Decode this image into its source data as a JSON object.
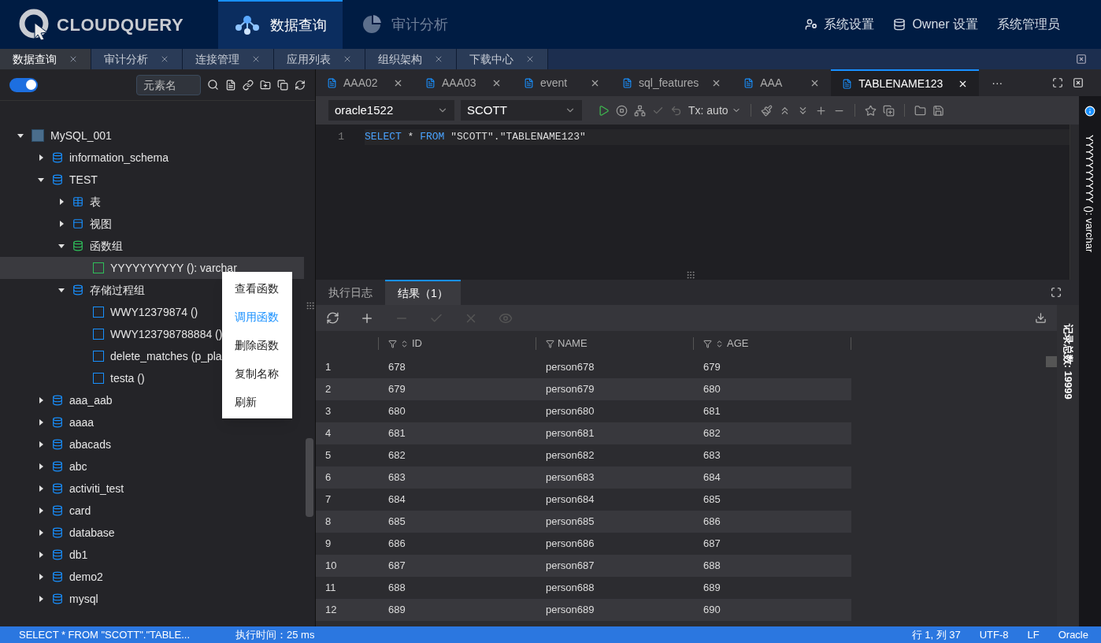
{
  "header": {
    "logo": "CLOUDQUERY",
    "nav": [
      {
        "label": "数据查询",
        "selected": true
      },
      {
        "label": "审计分析",
        "selected": false
      }
    ],
    "links": [
      {
        "label": "系统设置"
      },
      {
        "label": "Owner 设置"
      }
    ],
    "user": "系统管理员"
  },
  "page_tabs": [
    {
      "label": "数据查询",
      "selected": true
    },
    {
      "label": "审计分析",
      "selected": false
    },
    {
      "label": "连接管理",
      "selected": false
    },
    {
      "label": "应用列表",
      "selected": false
    },
    {
      "label": "组织架构",
      "selected": false
    },
    {
      "label": "下载中心",
      "selected": false
    }
  ],
  "sidebar": {
    "theme_toggle": {
      "on": true
    },
    "search": {
      "placeholder": "元素名"
    },
    "tree": [
      {
        "label": "MySQL_001",
        "kind": "connection",
        "expanded": true,
        "selected": false,
        "children": [
          {
            "label": "information_schema",
            "kind": "database",
            "expanded": false,
            "selected": false
          },
          {
            "label": "TEST",
            "kind": "database",
            "expanded": true,
            "selected": false,
            "children": [
              {
                "label": "表",
                "kind": "table_group",
                "expanded": false,
                "selected": false
              },
              {
                "label": "视图",
                "kind": "view_group",
                "expanded": false,
                "selected": false
              },
              {
                "label": "函数组",
                "kind": "function_group",
                "expanded": true,
                "selected": false,
                "children": [
                  {
                    "label": "YYYYYYYYYY (): varchar",
                    "kind": "function",
                    "selected": true
                  }
                ]
              },
              {
                "label": "存储过程组",
                "kind": "procedure_group",
                "expanded": true,
                "selected": false,
                "children": [
                  {
                    "label": "WWY12379874 ()",
                    "kind": "procedure",
                    "selected": false
                  },
                  {
                    "label": "WWY123798788884 ()",
                    "kind": "procedure",
                    "selected": false
                  },
                  {
                    "label": "delete_matches (p_pla",
                    "kind": "procedure",
                    "selected": false
                  },
                  {
                    "label": "testa ()",
                    "kind": "procedure",
                    "selected": false
                  }
                ]
              }
            ]
          },
          {
            "label": "aaa_aab",
            "kind": "database",
            "expanded": false,
            "selected": false
          },
          {
            "label": "aaaa",
            "kind": "database",
            "expanded": false,
            "selected": false
          },
          {
            "label": "abacads",
            "kind": "database",
            "expanded": false,
            "selected": false
          },
          {
            "label": "abc",
            "kind": "database",
            "expanded": false,
            "selected": false
          },
          {
            "label": "activiti_test",
            "kind": "database",
            "expanded": false,
            "selected": false
          },
          {
            "label": "card",
            "kind": "database",
            "expanded": false,
            "selected": false
          },
          {
            "label": "database",
            "kind": "database",
            "expanded": false,
            "selected": false
          },
          {
            "label": "db1",
            "kind": "database",
            "expanded": false,
            "selected": false
          },
          {
            "label": "demo2",
            "kind": "database",
            "expanded": false,
            "selected": false
          },
          {
            "label": "mysql",
            "kind": "database",
            "expanded": false,
            "selected": false
          }
        ]
      }
    ]
  },
  "context_menu": [
    {
      "label": "查看函数",
      "selected": false
    },
    {
      "label": "调用函数",
      "selected": true
    },
    {
      "label": "删除函数",
      "selected": false
    },
    {
      "label": "复制名称",
      "selected": false
    },
    {
      "label": "刷新",
      "selected": false
    }
  ],
  "editor_tabs": [
    {
      "label": "AAA02",
      "selected": false
    },
    {
      "label": "AAA03",
      "selected": false
    },
    {
      "label": "event",
      "selected": false
    },
    {
      "label": "sql_features",
      "selected": false
    },
    {
      "label": "AAA",
      "selected": false
    },
    {
      "label": "TABLENAME123",
      "selected": true
    }
  ],
  "editor_tabs_more": "···",
  "toolbar": {
    "connection": "oracle1522",
    "schema": "SCOTT",
    "transaction": "Tx: auto"
  },
  "editor": {
    "lines": [
      {
        "number": "1",
        "tokens": [
          {
            "text": "SELECT",
            "kind": "keyword"
          },
          {
            "text": " * ",
            "kind": "plain"
          },
          {
            "text": "FROM",
            "kind": "keyword"
          },
          {
            "text": " \"SCOTT\".\"TABLENAME123\"",
            "kind": "plain"
          }
        ]
      }
    ]
  },
  "result_tabs": [
    {
      "label": "执行日志",
      "selected": false
    },
    {
      "label": "结果（1）",
      "selected": true
    }
  ],
  "table": {
    "columns": [
      "ID",
      "NAME",
      "AGE"
    ],
    "rows": [
      {
        "number": "1",
        "cells": [
          "678",
          "person678",
          "679"
        ]
      },
      {
        "number": "2",
        "cells": [
          "679",
          "person679",
          "680"
        ]
      },
      {
        "number": "3",
        "cells": [
          "680",
          "person680",
          "681"
        ]
      },
      {
        "number": "4",
        "cells": [
          "681",
          "person681",
          "682"
        ]
      },
      {
        "number": "5",
        "cells": [
          "682",
          "person682",
          "683"
        ]
      },
      {
        "number": "6",
        "cells": [
          "683",
          "person683",
          "684"
        ]
      },
      {
        "number": "7",
        "cells": [
          "684",
          "person684",
          "685"
        ]
      },
      {
        "number": "8",
        "cells": [
          "685",
          "person685",
          "686"
        ]
      },
      {
        "number": "9",
        "cells": [
          "686",
          "person686",
          "687"
        ]
      },
      {
        "number": "10",
        "cells": [
          "687",
          "person687",
          "688"
        ]
      },
      {
        "number": "11",
        "cells": [
          "688",
          "person688",
          "689"
        ]
      },
      {
        "number": "12",
        "cells": [
          "689",
          "person689",
          "690"
        ]
      }
    ]
  },
  "record_count": "记录总数: 19999",
  "side_panel": "YYYYYYYYYY (): varchar",
  "status_bar": {
    "query": "SELECT * FROM \"SCOTT\".\"TABLE...",
    "exec_time": "执行时间：25 ms",
    "position": "行 1, 列 37",
    "encoding": "UTF-8",
    "line_ending": "LF",
    "dialect": "Oracle"
  }
}
